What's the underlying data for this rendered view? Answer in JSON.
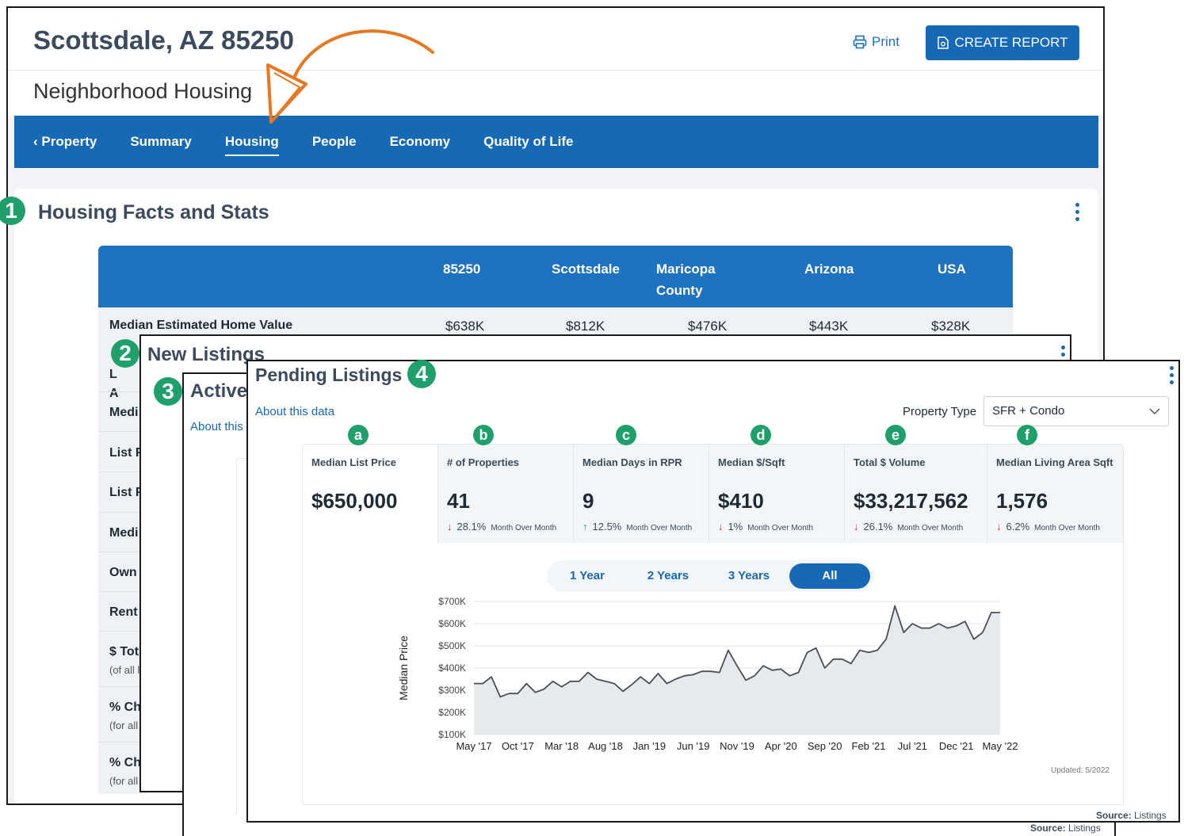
{
  "header": {
    "address": "Scottsdale, AZ 85250",
    "subtitle": "Neighborhood Housing",
    "print_label": "Print",
    "create_report_label": "CREATE REPORT"
  },
  "nav": {
    "back_label": "Property",
    "tabs": [
      "Summary",
      "Housing",
      "People",
      "Economy",
      "Quality of Life"
    ],
    "active_tab": "Housing"
  },
  "badges": [
    "1",
    "2",
    "3",
    "4"
  ],
  "stat_letters": [
    "a",
    "b",
    "c",
    "d",
    "e",
    "f"
  ],
  "facts": {
    "title": "Housing Facts and Stats",
    "columns": [
      "85250",
      "Scottsdale",
      "Maricopa County",
      "Arizona",
      "USA"
    ],
    "first_row": {
      "label": "Median Estimated Home Value",
      "values": [
        "$638K",
        "$812K",
        "$476K",
        "$443K",
        "$328K"
      ]
    },
    "truncated_rows": [
      {
        "label": "L",
        "sub": ""
      },
      {
        "label": "A",
        "sub": ""
      },
      {
        "label": "Medi",
        "sub": ""
      },
      {
        "label": "List F",
        "sub": ""
      },
      {
        "label": "List F",
        "sub": ""
      },
      {
        "label": "Medi",
        "sub": ""
      },
      {
        "label": "Own",
        "sub": ""
      },
      {
        "label": "Rent",
        "sub": ""
      },
      {
        "label": "$ Tot",
        "sub": "(of all l"
      },
      {
        "label": "% Ch",
        "sub": "(for all"
      },
      {
        "label": "% Ch",
        "sub": "(for all"
      }
    ]
  },
  "new_listings": {
    "title": "New Listings"
  },
  "active_listings": {
    "title": "Active",
    "about_label": "About this",
    "source_prefix": "Source:",
    "source_value": "Listings"
  },
  "pending": {
    "title": "Pending Listings",
    "about_label": "About this data",
    "property_type_label": "Property Type",
    "property_type_value": "SFR + Condo",
    "stats": [
      {
        "label": "Median List Price",
        "value": "$650,000",
        "change": "",
        "direction": "",
        "period": ""
      },
      {
        "label": "# of Properties",
        "value": "41",
        "change": "28.1%",
        "direction": "down",
        "period": "Month Over Month"
      },
      {
        "label": "Median Days in RPR",
        "value": "9",
        "change": "12.5%",
        "direction": "up",
        "period": "Month Over Month"
      },
      {
        "label": "Median $/Sqft",
        "value": "$410",
        "change": "1%",
        "direction": "down",
        "period": "Month Over Month"
      },
      {
        "label": "Total $ Volume",
        "value": "$33,217,562",
        "change": "26.1%",
        "direction": "down",
        "period": "Month Over Month"
      },
      {
        "label": "Median Living Area Sqft",
        "value": "1,576",
        "change": "6.2%",
        "direction": "down",
        "period": "Month Over Month"
      }
    ],
    "ranges": [
      "1 Year",
      "2 Years",
      "3 Years",
      "All"
    ],
    "selected_range": "All",
    "updated_label": "Updated: 5/2022",
    "source_prefix": "Source:",
    "source_value": "Listings"
  },
  "colors": {
    "brand_blue": "#1769b5",
    "badge_green": "#1fa06b",
    "down_red": "#d9342b",
    "annotation_orange": "#e87722"
  },
  "chart_data": {
    "type": "area",
    "title": "",
    "xlabel": "",
    "ylabel": "Median Price",
    "x_ticks": [
      "May '17",
      "Oct '17",
      "Mar '18",
      "Aug '18",
      "Jan '19",
      "Jun '19",
      "Nov '19",
      "Apr '20",
      "Sep '20",
      "Feb '21",
      "Jul '21",
      "Dec '21",
      "May '22"
    ],
    "y_ticks": [
      "$100K",
      "$200K",
      "$300K",
      "$400K",
      "$500K",
      "$600K",
      "$700K"
    ],
    "ylim": [
      100000,
      700000
    ],
    "grid": true,
    "legend": "none",
    "series": [
      {
        "values": [
          330000,
          330000,
          360000,
          270000,
          285000,
          285000,
          330000,
          290000,
          305000,
          340000,
          315000,
          340000,
          340000,
          380000,
          350000,
          340000,
          330000,
          295000,
          325000,
          360000,
          330000,
          375000,
          330000,
          350000,
          365000,
          370000,
          385000,
          385000,
          380000,
          480000,
          410000,
          345000,
          365000,
          410000,
          390000,
          395000,
          365000,
          380000,
          470000,
          490000,
          400000,
          440000,
          440000,
          420000,
          480000,
          470000,
          480000,
          530000,
          680000,
          560000,
          600000,
          580000,
          580000,
          600000,
          580000,
          590000,
          610000,
          530000,
          560000,
          650000,
          650000
        ]
      }
    ]
  }
}
